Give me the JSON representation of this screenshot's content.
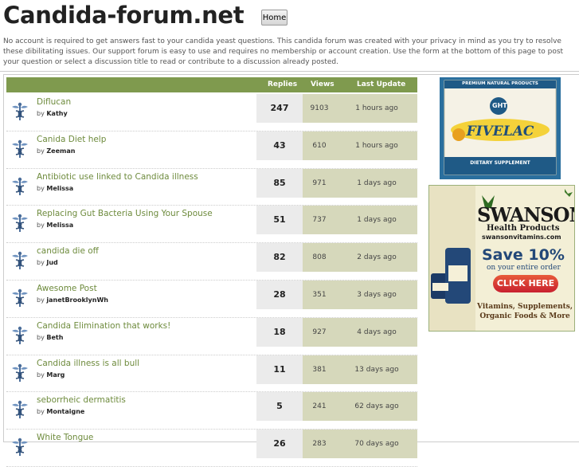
{
  "header": {
    "site_title": "Candida-forum.net",
    "home_label": "Home"
  },
  "intro": "No account is required to get answers fast to your candida yeast questions. This candida forum was created with your privacy in mind as you try to resolve these dibilitating issues. Our support forum is easy to use and requires no membership or account creation. Use the form at the bottom of this page to post your question or select a discussion title to read or contribute to a discussion already posted.",
  "table": {
    "columns": {
      "replies": "Replies",
      "views": "Views",
      "last_update": "Last Update"
    },
    "by_prefix": "by",
    "rows": [
      {
        "title": "Diflucan",
        "author": "Kathy",
        "replies": "247",
        "views": "9103",
        "updated": "1 hours ago"
      },
      {
        "title": "Canida Diet help",
        "author": "Zeeman",
        "replies": "43",
        "views": "610",
        "updated": "1 hours ago"
      },
      {
        "title": "Antibiotic use linked to Candida illness",
        "author": "Melissa",
        "replies": "85",
        "views": "971",
        "updated": "1 days ago"
      },
      {
        "title": "Replacing Gut Bacteria Using Your Spouse",
        "author": "Melissa",
        "replies": "51",
        "views": "737",
        "updated": "1 days ago"
      },
      {
        "title": "candida die off",
        "author": "Jud",
        "replies": "82",
        "views": "808",
        "updated": "2 days ago"
      },
      {
        "title": "Awesome Post",
        "author": "janetBrooklynWh",
        "replies": "28",
        "views": "351",
        "updated": "3 days ago"
      },
      {
        "title": "Candida Elimination that works!",
        "author": "Beth",
        "replies": "18",
        "views": "927",
        "updated": "4 days ago"
      },
      {
        "title": "Candida illness is all bull",
        "author": "Marg",
        "replies": "11",
        "views": "381",
        "updated": "13 days ago"
      },
      {
        "title": "seborrheic dermatitis",
        "author": "Montaigne",
        "replies": "5",
        "views": "241",
        "updated": "62 days ago"
      },
      {
        "title": "White Tongue",
        "author": "",
        "replies": "26",
        "views": "283",
        "updated": "70 days ago"
      }
    ]
  },
  "ads": {
    "fivelac": {
      "brand": "GHT",
      "top_text": "PREMIUM NATURAL PRODUCTS",
      "product": "FIVELAC",
      "sub": "DIETARY SUPPLEMENT"
    },
    "swanson": {
      "brand": "SWANSON",
      "tagline": "Health Products",
      "url": "swansonvitamins.com",
      "offer": "Save 10%",
      "offer_sub": "on your entire order",
      "cta": "CLICK HERE",
      "footer": "Vitamins, Supplements, Organic Foods & More"
    }
  },
  "colors": {
    "header_green": "#7f9a4e",
    "link_green": "#6e8b3d",
    "swanson_red": "#c8202f"
  },
  "icons": {
    "topic": "caduceus-icon"
  }
}
